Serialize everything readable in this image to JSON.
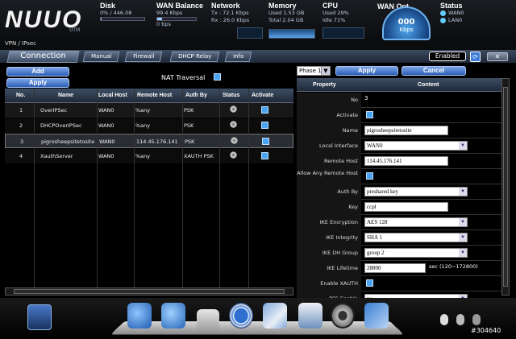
{
  "header": {
    "logo": "NUUO",
    "logo_sub": "UTM",
    "disk": {
      "title": "Disk",
      "line1": "0% / 446.08",
      "line2": "1",
      "progress": 0.02
    },
    "wan_balance": {
      "title": "WAN Balance",
      "line1": "99.4 Kbps",
      "line2": "0 bps"
    },
    "network": {
      "title": "Network",
      "tx": "Tx : 72.1 Kbps",
      "rx": "Rx : 26.0 Kbps"
    },
    "memory": {
      "title": "Memory",
      "used": "Used  1.53 GB",
      "total": "Total  2.04 GB"
    },
    "cpu": {
      "title": "CPU",
      "used": "Used   29%",
      "idle": "Idle    71%"
    },
    "wan_opt": {
      "title": "WAN Opt.",
      "value": "000",
      "unit": "Kbps"
    },
    "status": {
      "title": "Status",
      "items": [
        "WAN0",
        "LAN0"
      ]
    }
  },
  "breadcrumb": "VPN / IPsec",
  "tabs": [
    "Connection",
    "Manual",
    "Firewall",
    "DHCP Relay",
    "Info"
  ],
  "enabled_label": "Enabled",
  "close_label": "✕",
  "buttons": {
    "add": "Add",
    "apply": "Apply",
    "phase_apply": "Apply",
    "cancel": "Cancel"
  },
  "nat_traversal": "NAT Traversal",
  "table": {
    "headers": [
      "No.",
      "Name",
      "Local Host",
      "Remote Host",
      "Auth By",
      "Status",
      "Activate"
    ],
    "rows": [
      {
        "no": "1",
        "name": "OverIPSec",
        "local": "WAN0",
        "remote": "%any",
        "auth": "PSK"
      },
      {
        "no": "2",
        "name": "DHCPOverIPSec",
        "local": "WAN0",
        "remote": "%any",
        "auth": "PSK"
      },
      {
        "no": "3",
        "name": "pigrosheepsitetosite",
        "local": "WAN0",
        "remote": "114.45.176.141",
        "auth": "PSK"
      },
      {
        "no": "4",
        "name": "XauthServer",
        "local": "WAN0",
        "remote": "%any",
        "auth": "XAUTH PSK"
      }
    ]
  },
  "phase": "Phase 1",
  "props": {
    "headers": [
      "Property",
      "Content"
    ],
    "rows": [
      {
        "label": "No",
        "value": "3",
        "kind": "text"
      },
      {
        "label": "Activate",
        "kind": "check"
      },
      {
        "label": "Name",
        "value": "pigrosheepsitetosite",
        "kind": "input"
      },
      {
        "label": "Local Interface",
        "value": "WAN0",
        "kind": "select"
      },
      {
        "label": "Remote Host",
        "value": "114.45.176.141",
        "kind": "input"
      },
      {
        "label": "Allow Any Remote Host",
        "kind": "check"
      },
      {
        "label": "Auth By",
        "value": "preshared key",
        "kind": "select"
      },
      {
        "label": "Key",
        "value": "ccpl",
        "kind": "input"
      },
      {
        "label": "IKE Encryption",
        "value": "AES 128",
        "kind": "select"
      },
      {
        "label": "IKE Integrity",
        "value": "SHA 1",
        "kind": "select"
      },
      {
        "label": "IKE DH Group",
        "value": "group 2",
        "kind": "select"
      },
      {
        "label": "IKE Lifetime",
        "value": "28800",
        "suffix": "sec (120~172800)",
        "kind": "input"
      },
      {
        "label": "Enable XAUTH",
        "kind": "check"
      },
      {
        "label": "PFS Enable",
        "value": "no",
        "kind": "select"
      }
    ]
  },
  "watermark": "#304640"
}
